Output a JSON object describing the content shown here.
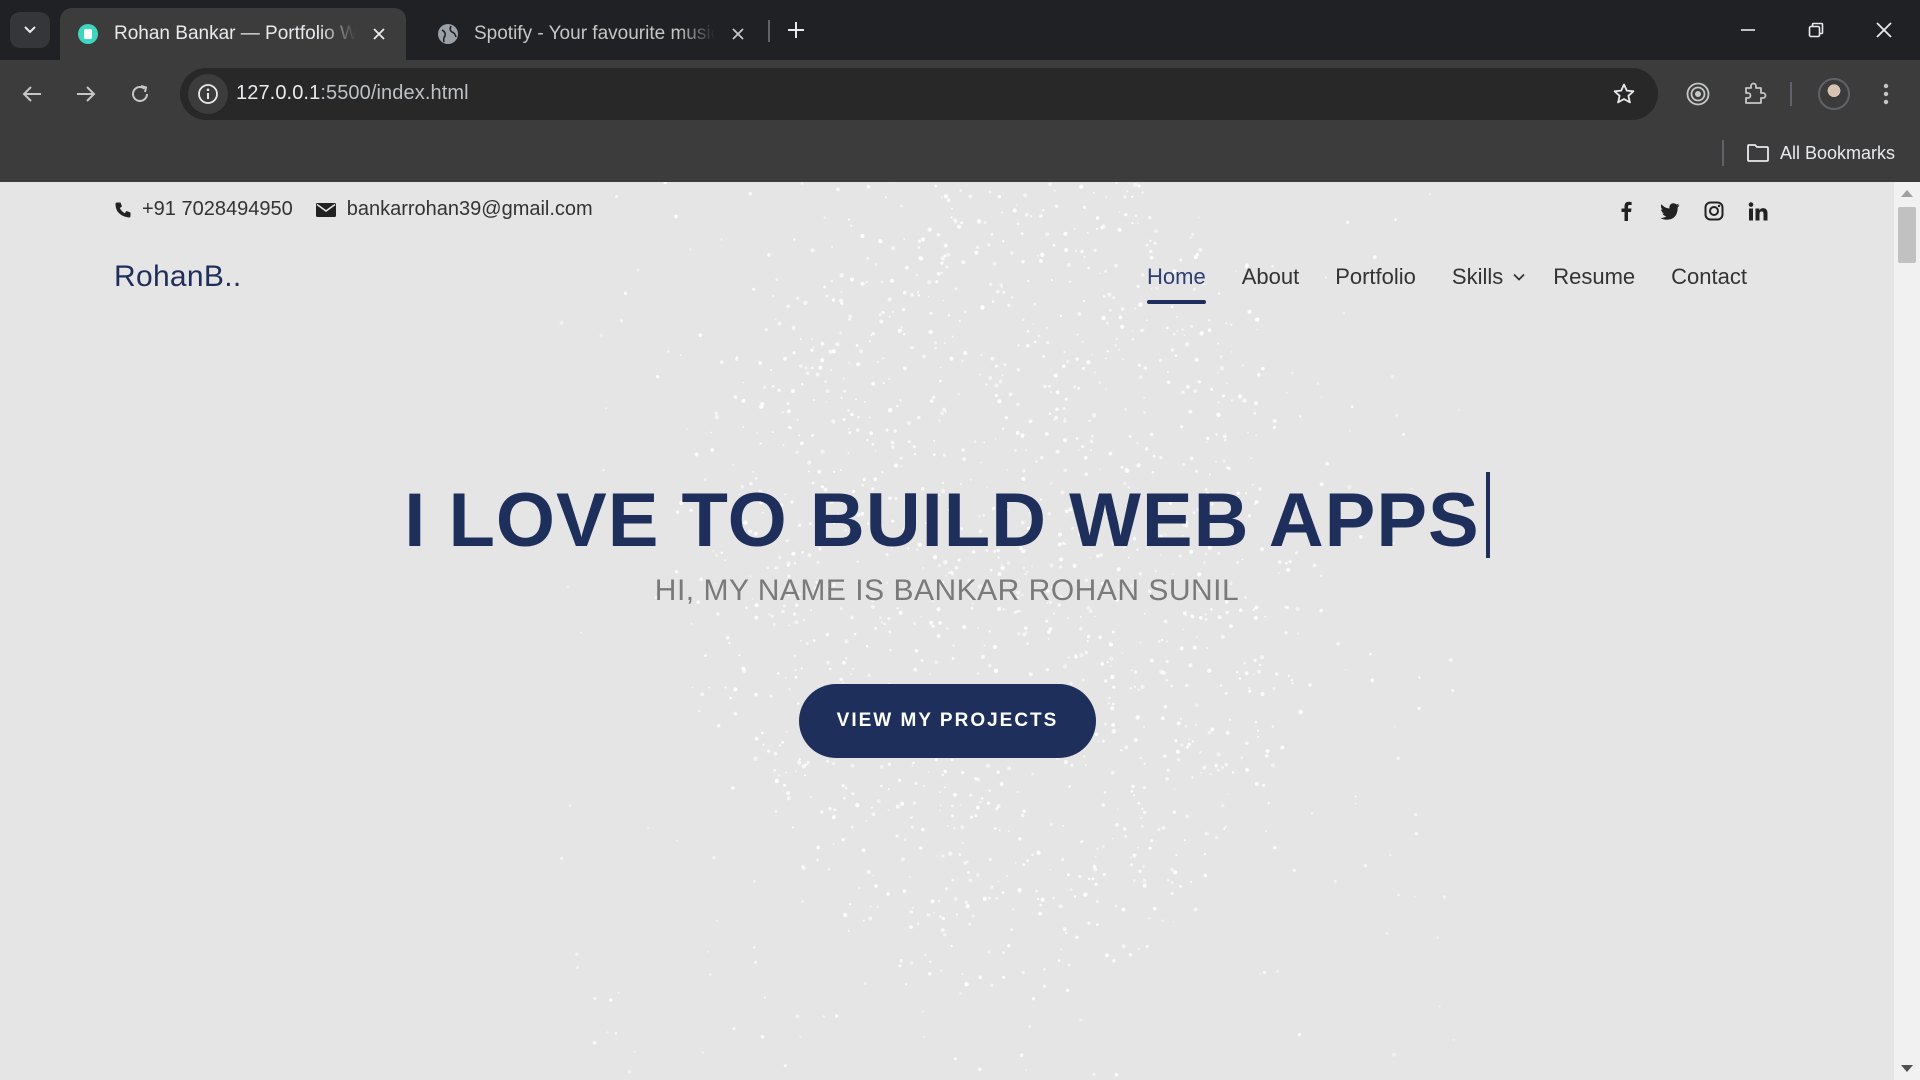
{
  "browser": {
    "tabs": [
      {
        "title": "Rohan Bankar — Portfolio Website",
        "active": true
      },
      {
        "title": "Spotify - Your favourite music is here",
        "active": false
      }
    ],
    "url_host": "127.0.0.1",
    "url_path": ":5500/index.html",
    "bookmarks_label": "All Bookmarks"
  },
  "page": {
    "contact": {
      "phone": "+91 7028494950",
      "email": "bankarrohan39@gmail.com"
    },
    "socials": [
      "facebook-icon",
      "twitter-icon",
      "instagram-icon",
      "linkedin-icon"
    ],
    "logo": "RohanB..",
    "nav": {
      "home": "Home",
      "about": "About",
      "portfolio": "Portfolio",
      "skills": "Skills",
      "resume": "Resume",
      "contact": "Contact"
    },
    "hero": {
      "title_light": "I LOVE TO BUILD",
      "title_bold": "WEB APPS",
      "subtitle": "HI, MY NAME IS BANKAR ROHAN SUNIL",
      "cta": "VIEW MY PROJECTS"
    }
  },
  "colors": {
    "accent": "#1f2f5c",
    "page_bg": "#e5e5e5",
    "chrome_bg": "#3c3c3c"
  }
}
